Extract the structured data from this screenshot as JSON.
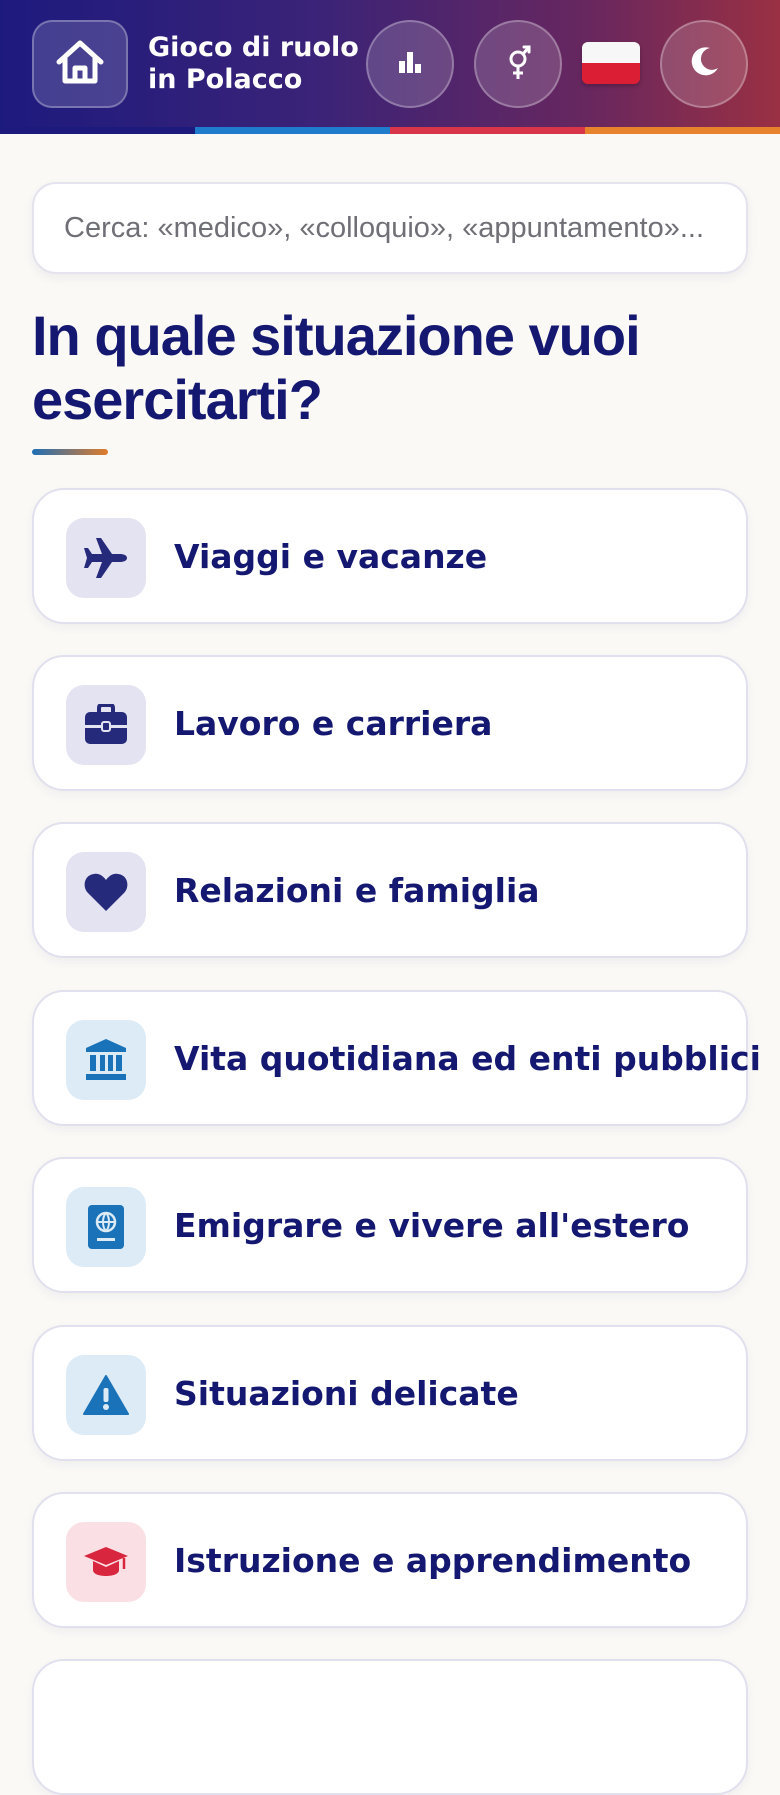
{
  "header": {
    "title_line1": "Gioco di ruolo",
    "title_line2": "in Polacco",
    "buttons": [
      {
        "icon": "home-icon"
      },
      {
        "icon": "bar-chart-icon"
      },
      {
        "icon": "gender-icon"
      },
      {
        "icon": "poland-flag-icon"
      },
      {
        "icon": "moon-icon"
      }
    ],
    "stripe_colors": [
      "#1d1a7e",
      "#1f7ccd",
      "#d93548",
      "#e8832d"
    ]
  },
  "search": {
    "placeholder": "Cerca: «medico», «colloquio», «appuntamento»..."
  },
  "main": {
    "title": "In quale situazione vuoi esercitarti?",
    "categories": [
      {
        "label": "Viaggi e vacanze",
        "icon": "airplane-icon",
        "color": "#262a7a"
      },
      {
        "label": "Lavoro e carriera",
        "icon": "briefcase-icon",
        "color": "#262a7a"
      },
      {
        "label": "Relazioni e famiglia",
        "icon": "heart-icon",
        "color": "#262a7a"
      },
      {
        "label": "Vita quotidiana ed enti pubblici",
        "icon": "bank-icon",
        "color": "#1a72b8"
      },
      {
        "label": "Emigrare e vivere all'estero",
        "icon": "passport-icon",
        "color": "#1a72b8"
      },
      {
        "label": "Situazioni delicate",
        "icon": "warning-icon",
        "color": "#1a72b8"
      },
      {
        "label": "Istruzione e apprendimento",
        "icon": "graduation-cap-icon",
        "color": "#d8263e"
      }
    ]
  }
}
